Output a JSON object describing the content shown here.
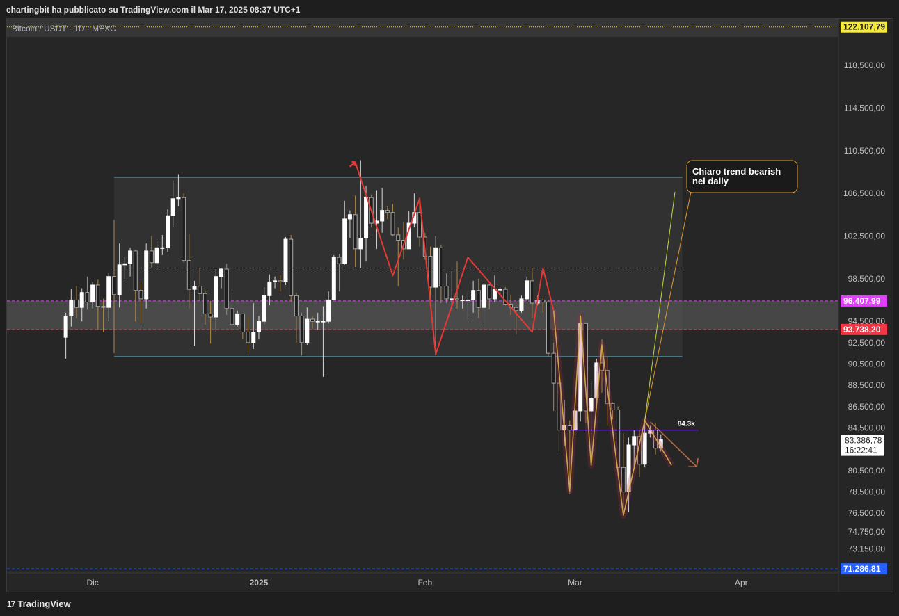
{
  "header": {
    "published_by": "chartingbit ha pubblicato su TradingView.com il Mar 17, 2025 08:37 UTC+1"
  },
  "symbol": {
    "title": "Bitcoin / USDT · 1D · MEXC"
  },
  "footer": {
    "brand": "TradingView",
    "logo_mark": "17"
  },
  "colors": {
    "up": "#ffffff",
    "down": "#1e1e1e",
    "wick": "#9a9a9a",
    "zigzag": "#e53935",
    "trend": "#c8a84b",
    "magenta": "#e040fb",
    "red_level": "#f23645",
    "blue_level": "#2962ff",
    "yellow_label": "#ffeb3b"
  },
  "chart_data": {
    "type": "candlestick",
    "ylim": [
      70000,
      124000
    ],
    "y_ticks": [
      {
        "value": 118500,
        "label": "118.500,00"
      },
      {
        "value": 114500,
        "label": "114.500,00"
      },
      {
        "value": 110500,
        "label": "110.500,00"
      },
      {
        "value": 106500,
        "label": "106.500,00"
      },
      {
        "value": 102500,
        "label": "102.500,00"
      },
      {
        "value": 98500,
        "label": "98.500,00"
      },
      {
        "value": 94500,
        "label": "94.500,00"
      },
      {
        "value": 92500,
        "label": "92.500,00"
      },
      {
        "value": 90500,
        "label": "90.500,00"
      },
      {
        "value": 88500,
        "label": "88.500,00"
      },
      {
        "value": 86500,
        "label": "86.500,00"
      },
      {
        "value": 84500,
        "label": "84.500,00"
      },
      {
        "value": 80500,
        "label": "80.500,00"
      },
      {
        "value": 78500,
        "label": "78.500,00"
      },
      {
        "value": 76500,
        "label": "76.500,00"
      },
      {
        "value": 74750,
        "label": "74.750,00"
      },
      {
        "value": 73150,
        "label": "73.150,00"
      }
    ],
    "x_ticks": [
      {
        "date": "2024-12-01",
        "label": "Dic",
        "bold": false
      },
      {
        "date": "2025-01-01",
        "label": "2025",
        "bold": true
      },
      {
        "date": "2025-02-01",
        "label": "Feb",
        "bold": false
      },
      {
        "date": "2025-03-01",
        "label": "Mar",
        "bold": false
      },
      {
        "date": "2025-04-01",
        "label": "Apr",
        "bold": false
      }
    ],
    "price_labels": [
      {
        "value": 122107.79,
        "label": "122.107,79",
        "style": "yellow"
      },
      {
        "value": 96407.99,
        "label": "96.407,99",
        "style": "magenta"
      },
      {
        "value": 93738.2,
        "label": "93.738,20",
        "style": "red"
      },
      {
        "value": 83386.78,
        "label": "83.386,78",
        "style": "current",
        "countdown": "16:22:41"
      },
      {
        "value": 71286.81,
        "label": "71.286,81",
        "style": "blue"
      }
    ],
    "levels": [
      {
        "value": 122107.79,
        "style": "yellow-dotted"
      },
      {
        "value": 96407.99,
        "style": "magenta-dashed"
      },
      {
        "value": 93738.2,
        "style": "red-dashed"
      },
      {
        "value": 71286.81,
        "style": "blue-dashed"
      }
    ],
    "range_box": {
      "from": "2024-12-05",
      "to": "2025-03-21",
      "top": 108000,
      "bottom": 91200,
      "mid": 99500
    },
    "zone": {
      "top": 96407.99,
      "bottom": 93738.2
    },
    "annotation_level": {
      "value": 84300,
      "label": "84.3k",
      "from": "2025-02-28",
      "to": "2025-03-24"
    },
    "callout": {
      "text_line1": "Chiaro trend bearish",
      "text_line2": "nel daily",
      "pointer_date": "2025-03-14",
      "pointer_value": 85200
    },
    "zigzag": [
      {
        "d": "2025-01-19",
        "v": 109400
      },
      {
        "d": "2025-01-26",
        "v": 98800
      },
      {
        "d": "2025-01-31",
        "v": 106000
      },
      {
        "d": "2025-02-03",
        "v": 91400
      },
      {
        "d": "2025-02-09",
        "v": 100500
      },
      {
        "d": "2025-02-21",
        "v": 93500
      },
      {
        "d": "2025-02-23",
        "v": 99500
      },
      {
        "d": "2025-02-25",
        "v": 95500
      }
    ],
    "trend_path": [
      {
        "d": "2025-02-25",
        "v": 95500
      },
      {
        "d": "2025-02-28",
        "v": 78600
      },
      {
        "d": "2025-03-02",
        "v": 95000
      },
      {
        "d": "2025-03-04",
        "v": 81000
      },
      {
        "d": "2025-03-06",
        "v": 92300
      },
      {
        "d": "2025-03-10",
        "v": 76300
      },
      {
        "d": "2025-03-14",
        "v": 85200
      },
      {
        "d": "2025-03-19",
        "v": 81000
      }
    ],
    "candles": [
      {
        "d": "2024-11-26",
        "o": 93000,
        "h": 95300,
        "l": 91000,
        "c": 95000
      },
      {
        "d": "2024-11-27",
        "o": 95000,
        "h": 97500,
        "l": 94000,
        "c": 96500
      },
      {
        "d": "2024-11-28",
        "o": 96500,
        "h": 97800,
        "l": 94800,
        "c": 95800
      },
      {
        "d": "2024-11-29",
        "o": 95800,
        "h": 97600,
        "l": 94500,
        "c": 97200
      },
      {
        "d": "2024-11-30",
        "o": 97200,
        "h": 98700,
        "l": 95600,
        "c": 96300
      },
      {
        "d": "2024-12-01",
        "o": 96300,
        "h": 98200,
        "l": 95700,
        "c": 97900
      },
      {
        "d": "2024-12-02",
        "o": 97900,
        "h": 98400,
        "l": 93700,
        "c": 95900
      },
      {
        "d": "2024-12-03",
        "o": 95900,
        "h": 96600,
        "l": 93500,
        "c": 95800
      },
      {
        "d": "2024-12-04",
        "o": 95800,
        "h": 99000,
        "l": 94500,
        "c": 98700
      },
      {
        "d": "2024-12-05",
        "o": 98700,
        "h": 104000,
        "l": 91500,
        "c": 97000
      },
      {
        "d": "2024-12-06",
        "o": 97000,
        "h": 101800,
        "l": 95800,
        "c": 99800
      },
      {
        "d": "2024-12-07",
        "o": 99800,
        "h": 100500,
        "l": 98500,
        "c": 99900
      },
      {
        "d": "2024-12-08",
        "o": 99900,
        "h": 101400,
        "l": 98700,
        "c": 101100
      },
      {
        "d": "2024-12-09",
        "o": 101100,
        "h": 101200,
        "l": 94500,
        "c": 97400
      },
      {
        "d": "2024-12-10",
        "o": 97400,
        "h": 98200,
        "l": 94300,
        "c": 96600
      },
      {
        "d": "2024-12-11",
        "o": 96600,
        "h": 101800,
        "l": 95700,
        "c": 101100
      },
      {
        "d": "2024-12-12",
        "o": 101100,
        "h": 102500,
        "l": 99500,
        "c": 100000
      },
      {
        "d": "2024-12-13",
        "o": 100000,
        "h": 102000,
        "l": 99200,
        "c": 101400
      },
      {
        "d": "2024-12-14",
        "o": 101400,
        "h": 102600,
        "l": 100700,
        "c": 101400
      },
      {
        "d": "2024-12-15",
        "o": 101400,
        "h": 105000,
        "l": 101000,
        "c": 104400
      },
      {
        "d": "2024-12-16",
        "o": 104400,
        "h": 107700,
        "l": 103300,
        "c": 106000
      },
      {
        "d": "2024-12-17",
        "o": 106000,
        "h": 108300,
        "l": 105300,
        "c": 106100
      },
      {
        "d": "2024-12-18",
        "o": 106100,
        "h": 106500,
        "l": 100000,
        "c": 100200
      },
      {
        "d": "2024-12-19",
        "o": 100200,
        "h": 102700,
        "l": 95700,
        "c": 97500
      },
      {
        "d": "2024-12-20",
        "o": 97500,
        "h": 98300,
        "l": 92200,
        "c": 97800
      },
      {
        "d": "2024-12-21",
        "o": 97800,
        "h": 99500,
        "l": 96400,
        "c": 97100
      },
      {
        "d": "2024-12-22",
        "o": 97100,
        "h": 97400,
        "l": 94200,
        "c": 95200
      },
      {
        "d": "2024-12-23",
        "o": 95200,
        "h": 96400,
        "l": 92400,
        "c": 94900
      },
      {
        "d": "2024-12-24",
        "o": 94900,
        "h": 99400,
        "l": 93500,
        "c": 98700
      },
      {
        "d": "2024-12-25",
        "o": 98700,
        "h": 99500,
        "l": 97600,
        "c": 99400
      },
      {
        "d": "2024-12-26",
        "o": 99400,
        "h": 99900,
        "l": 95100,
        "c": 95700
      },
      {
        "d": "2024-12-27",
        "o": 95700,
        "h": 97200,
        "l": 93500,
        "c": 94200
      },
      {
        "d": "2024-12-28",
        "o": 94200,
        "h": 95500,
        "l": 94000,
        "c": 95200
      },
      {
        "d": "2024-12-29",
        "o": 95200,
        "h": 95200,
        "l": 92800,
        "c": 93500
      },
      {
        "d": "2024-12-30",
        "o": 93500,
        "h": 94900,
        "l": 91600,
        "c": 92500
      },
      {
        "d": "2024-12-31",
        "o": 92500,
        "h": 96200,
        "l": 91900,
        "c": 93500
      },
      {
        "d": "2025-01-01",
        "o": 93500,
        "h": 95000,
        "l": 92800,
        "c": 94500
      },
      {
        "d": "2025-01-02",
        "o": 94500,
        "h": 97700,
        "l": 94200,
        "c": 96900
      },
      {
        "d": "2025-01-03",
        "o": 96900,
        "h": 98900,
        "l": 96000,
        "c": 98200
      },
      {
        "d": "2025-01-04",
        "o": 98200,
        "h": 98700,
        "l": 97600,
        "c": 98300
      },
      {
        "d": "2025-01-05",
        "o": 98300,
        "h": 98800,
        "l": 97300,
        "c": 98200
      },
      {
        "d": "2025-01-06",
        "o": 98200,
        "h": 102400,
        "l": 97900,
        "c": 102200
      },
      {
        "d": "2025-01-07",
        "o": 102200,
        "h": 102600,
        "l": 96300,
        "c": 96900
      },
      {
        "d": "2025-01-08",
        "o": 96900,
        "h": 97200,
        "l": 92500,
        "c": 95000
      },
      {
        "d": "2025-01-09",
        "o": 95000,
        "h": 95300,
        "l": 91300,
        "c": 92500
      },
      {
        "d": "2025-01-10",
        "o": 92500,
        "h": 95800,
        "l": 92300,
        "c": 94700
      },
      {
        "d": "2025-01-11",
        "o": 94700,
        "h": 95000,
        "l": 93800,
        "c": 94500
      },
      {
        "d": "2025-01-12",
        "o": 94500,
        "h": 95300,
        "l": 93700,
        "c": 94500
      },
      {
        "d": "2025-01-13",
        "o": 94500,
        "h": 95900,
        "l": 89300,
        "c": 94500
      },
      {
        "d": "2025-01-14",
        "o": 94500,
        "h": 97300,
        "l": 94300,
        "c": 96500
      },
      {
        "d": "2025-01-15",
        "o": 96500,
        "h": 100700,
        "l": 96500,
        "c": 100500
      },
      {
        "d": "2025-01-16",
        "o": 100500,
        "h": 100800,
        "l": 97300,
        "c": 99900
      },
      {
        "d": "2025-01-17",
        "o": 99900,
        "h": 105800,
        "l": 99800,
        "c": 104100
      },
      {
        "d": "2025-01-18",
        "o": 104100,
        "h": 104900,
        "l": 102300,
        "c": 104500
      },
      {
        "d": "2025-01-19",
        "o": 104500,
        "h": 106300,
        "l": 99600,
        "c": 101300
      },
      {
        "d": "2025-01-20",
        "o": 101300,
        "h": 109600,
        "l": 99500,
        "c": 102300
      },
      {
        "d": "2025-01-21",
        "o": 102300,
        "h": 107200,
        "l": 100100,
        "c": 106100
      },
      {
        "d": "2025-01-22",
        "o": 106100,
        "h": 106400,
        "l": 103300,
        "c": 103700
      },
      {
        "d": "2025-01-23",
        "o": 103700,
        "h": 106800,
        "l": 101300,
        "c": 103900
      },
      {
        "d": "2025-01-24",
        "o": 103900,
        "h": 107000,
        "l": 102800,
        "c": 104900
      },
      {
        "d": "2025-01-25",
        "o": 104900,
        "h": 105300,
        "l": 104100,
        "c": 104700
      },
      {
        "d": "2025-01-26",
        "o": 104700,
        "h": 105500,
        "l": 102500,
        "c": 102600
      },
      {
        "d": "2025-01-27",
        "o": 102600,
        "h": 103300,
        "l": 97800,
        "c": 102100
      },
      {
        "d": "2025-01-28",
        "o": 102100,
        "h": 103800,
        "l": 100300,
        "c": 101300
      },
      {
        "d": "2025-01-29",
        "o": 101300,
        "h": 104800,
        "l": 101300,
        "c": 103700
      },
      {
        "d": "2025-01-30",
        "o": 103700,
        "h": 106500,
        "l": 103300,
        "c": 104700
      },
      {
        "d": "2025-01-31",
        "o": 104700,
        "h": 106100,
        "l": 101500,
        "c": 102400
      },
      {
        "d": "2025-02-01",
        "o": 102400,
        "h": 102800,
        "l": 100300,
        "c": 100600
      },
      {
        "d": "2025-02-02",
        "o": 100600,
        "h": 101500,
        "l": 96300,
        "c": 97700
      },
      {
        "d": "2025-02-03",
        "o": 97700,
        "h": 102500,
        "l": 91300,
        "c": 101400
      },
      {
        "d": "2025-02-04",
        "o": 101400,
        "h": 101700,
        "l": 96200,
        "c": 97800
      },
      {
        "d": "2025-02-05",
        "o": 97800,
        "h": 99000,
        "l": 96200,
        "c": 96600
      },
      {
        "d": "2025-02-06",
        "o": 96600,
        "h": 99200,
        "l": 95700,
        "c": 96600
      },
      {
        "d": "2025-02-07",
        "o": 96600,
        "h": 100100,
        "l": 95700,
        "c": 96500
      },
      {
        "d": "2025-02-08",
        "o": 96500,
        "h": 96900,
        "l": 95700,
        "c": 96500
      },
      {
        "d": "2025-02-09",
        "o": 96500,
        "h": 97300,
        "l": 94700,
        "c": 96500
      },
      {
        "d": "2025-02-10",
        "o": 96500,
        "h": 98300,
        "l": 95300,
        "c": 97400
      },
      {
        "d": "2025-02-11",
        "o": 97400,
        "h": 98500,
        "l": 94800,
        "c": 95800
      },
      {
        "d": "2025-02-12",
        "o": 95800,
        "h": 98100,
        "l": 94100,
        "c": 97900
      },
      {
        "d": "2025-02-13",
        "o": 97900,
        "h": 98000,
        "l": 95700,
        "c": 96600
      },
      {
        "d": "2025-02-14",
        "o": 96600,
        "h": 98800,
        "l": 96300,
        "c": 97500
      },
      {
        "d": "2025-02-15",
        "o": 97500,
        "h": 97700,
        "l": 97000,
        "c": 97500
      },
      {
        "d": "2025-02-16",
        "o": 97500,
        "h": 97700,
        "l": 96000,
        "c": 96100
      },
      {
        "d": "2025-02-17",
        "o": 96100,
        "h": 97000,
        "l": 95100,
        "c": 95800
      },
      {
        "d": "2025-02-18",
        "o": 95800,
        "h": 96000,
        "l": 93300,
        "c": 95500
      },
      {
        "d": "2025-02-19",
        "o": 95500,
        "h": 96900,
        "l": 95300,
        "c": 96600
      },
      {
        "d": "2025-02-20",
        "o": 96600,
        "h": 98700,
        "l": 96400,
        "c": 98300
      },
      {
        "d": "2025-02-21",
        "o": 98300,
        "h": 99500,
        "l": 94800,
        "c": 96200
      },
      {
        "d": "2025-02-22",
        "o": 96200,
        "h": 96900,
        "l": 96000,
        "c": 96500
      },
      {
        "d": "2025-02-23",
        "o": 96500,
        "h": 96700,
        "l": 95300,
        "c": 96300
      },
      {
        "d": "2025-02-24",
        "o": 96300,
        "h": 96500,
        "l": 91200,
        "c": 91500
      },
      {
        "d": "2025-02-25",
        "o": 91500,
        "h": 92500,
        "l": 86100,
        "c": 88700
      },
      {
        "d": "2025-02-26",
        "o": 88700,
        "h": 89300,
        "l": 82300,
        "c": 84300
      },
      {
        "d": "2025-02-27",
        "o": 84300,
        "h": 87100,
        "l": 82800,
        "c": 84700
      },
      {
        "d": "2025-02-28",
        "o": 84700,
        "h": 85200,
        "l": 78300,
        "c": 84300
      },
      {
        "d": "2025-03-01",
        "o": 84300,
        "h": 86500,
        "l": 83800,
        "c": 86100
      },
      {
        "d": "2025-03-02",
        "o": 86100,
        "h": 95000,
        "l": 85100,
        "c": 94300
      },
      {
        "d": "2025-03-03",
        "o": 94300,
        "h": 94400,
        "l": 85000,
        "c": 86100
      },
      {
        "d": "2025-03-04",
        "o": 86100,
        "h": 88900,
        "l": 81500,
        "c": 87300
      },
      {
        "d": "2025-03-05",
        "o": 87300,
        "h": 91000,
        "l": 86300,
        "c": 90600
      },
      {
        "d": "2025-03-06",
        "o": 90600,
        "h": 92800,
        "l": 87800,
        "c": 89900
      },
      {
        "d": "2025-03-07",
        "o": 89900,
        "h": 91200,
        "l": 84700,
        "c": 86800
      },
      {
        "d": "2025-03-08",
        "o": 86800,
        "h": 86900,
        "l": 85300,
        "c": 86200
      },
      {
        "d": "2025-03-09",
        "o": 86200,
        "h": 86500,
        "l": 80000,
        "c": 80800
      },
      {
        "d": "2025-03-10",
        "o": 80800,
        "h": 84000,
        "l": 76600,
        "c": 78500
      },
      {
        "d": "2025-03-11",
        "o": 78500,
        "h": 83600,
        "l": 76600,
        "c": 82900
      },
      {
        "d": "2025-03-12",
        "o": 82900,
        "h": 84300,
        "l": 80600,
        "c": 83700
      },
      {
        "d": "2025-03-13",
        "o": 83700,
        "h": 84300,
        "l": 79900,
        "c": 81100
      },
      {
        "d": "2025-03-14",
        "o": 81100,
        "h": 85300,
        "l": 80800,
        "c": 84000
      },
      {
        "d": "2025-03-15",
        "o": 84000,
        "h": 84700,
        "l": 83600,
        "c": 84300
      },
      {
        "d": "2025-03-16",
        "o": 84300,
        "h": 85000,
        "l": 82000,
        "c": 82600
      },
      {
        "d": "2025-03-17",
        "o": 82600,
        "h": 83900,
        "l": 82300,
        "c": 83387
      }
    ]
  }
}
